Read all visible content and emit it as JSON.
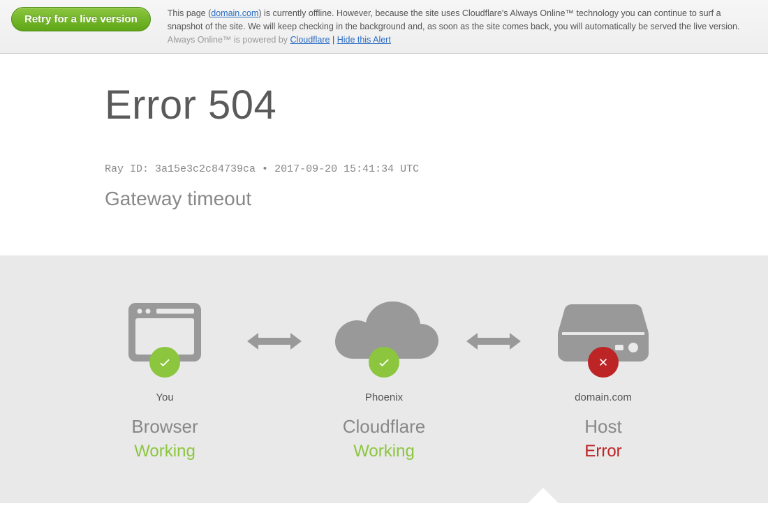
{
  "alert": {
    "retry_label": "Retry for a live version",
    "text_part1": "This page (",
    "domain_link": "domain.com",
    "text_part2": ") is currently offline. However, because the site uses Cloudflare's Always Online™ technology you can continue to surf a snapshot of the site. We will keep checking in the background and, as soon as the site comes back, you will automatically be served the live version. ",
    "powered_prefix": "Always Online™ is powered by ",
    "cloudflare_link": "Cloudflare",
    "separator": " | ",
    "hide_link": "Hide this Alert"
  },
  "main": {
    "error_title": "Error 504",
    "ray_prefix": "Ray ID: ",
    "ray_id": "3a15e3c2c84739ca",
    "bullet": " • ",
    "timestamp": "2017-09-20 15:41:34 UTC",
    "subtitle": "Gateway timeout"
  },
  "diagram": {
    "nodes": [
      {
        "top": "You",
        "mid": "Browser",
        "status": "Working",
        "ok": true
      },
      {
        "top": "Phoenix",
        "mid": "Cloudflare",
        "status": "Working",
        "ok": true
      },
      {
        "top": "domain.com",
        "mid": "Host",
        "status": "Error",
        "ok": false
      }
    ]
  },
  "colors": {
    "success": "#8cc63f",
    "error": "#bd2426",
    "icon_gray": "#999999"
  }
}
